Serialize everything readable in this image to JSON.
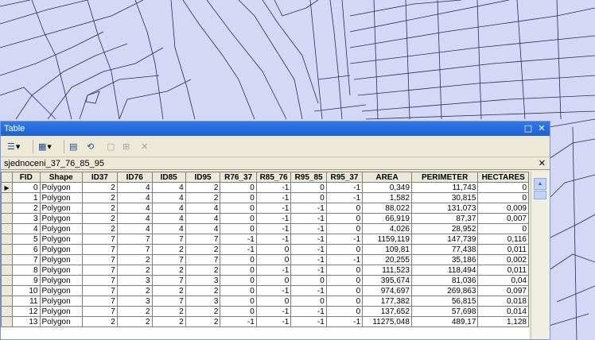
{
  "window": {
    "title": "Table",
    "maximize_glyph": "□",
    "close_glyph": "✕"
  },
  "toolbar": {
    "icons": [
      "table-options-icon",
      "related-tables-icon",
      "select-by-attributes-icon",
      "switch-selection-icon",
      "clear-selection-icon",
      "zoom-to-selected-icon",
      "delete-selected-icon"
    ]
  },
  "tab": {
    "label": "sjednoceni_37_76_85_95",
    "close_glyph": "✕"
  },
  "table": {
    "columns": [
      "FID",
      "Shape",
      "ID37",
      "ID76",
      "ID85",
      "ID95",
      "R76_37",
      "R85_76",
      "R95_85",
      "R95_37",
      "AREA",
      "PERIMETER",
      "HECTARES"
    ],
    "rows": [
      [
        "0",
        "Polygon",
        "2",
        "4",
        "4",
        "2",
        "0",
        "-1",
        "0",
        "-1",
        "0,349",
        "11,743",
        "0"
      ],
      [
        "1",
        "Polygon",
        "2",
        "4",
        "4",
        "2",
        "0",
        "-1",
        "0",
        "-1",
        "1,582",
        "30,815",
        "0"
      ],
      [
        "2",
        "Polygon",
        "2",
        "4",
        "4",
        "4",
        "0",
        "-1",
        "-1",
        "0",
        "88,022",
        "131,073",
        "0,009"
      ],
      [
        "3",
        "Polygon",
        "2",
        "4",
        "4",
        "4",
        "0",
        "-1",
        "-1",
        "0",
        "66,919",
        "87,37",
        "0,007"
      ],
      [
        "4",
        "Polygon",
        "2",
        "4",
        "4",
        "4",
        "0",
        "-1",
        "-1",
        "0",
        "4,026",
        "28,952",
        "0"
      ],
      [
        "5",
        "Polygon",
        "7",
        "7",
        "7",
        "7",
        "-1",
        "-1",
        "-1",
        "-1",
        "1159,119",
        "147,739",
        "0,116"
      ],
      [
        "6",
        "Polygon",
        "7",
        "7",
        "2",
        "2",
        "-1",
        "0",
        "-1",
        "0",
        "109,81",
        "77,438",
        "0,011"
      ],
      [
        "7",
        "Polygon",
        "7",
        "2",
        "7",
        "7",
        "0",
        "0",
        "-1",
        "-1",
        "20,255",
        "35,186",
        "0,002"
      ],
      [
        "8",
        "Polygon",
        "7",
        "2",
        "2",
        "2",
        "0",
        "-1",
        "-1",
        "0",
        "111,523",
        "118,494",
        "0,011"
      ],
      [
        "9",
        "Polygon",
        "7",
        "3",
        "7",
        "3",
        "0",
        "0",
        "0",
        "0",
        "395,674",
        "81,036",
        "0,04"
      ],
      [
        "10",
        "Polygon",
        "7",
        "2",
        "2",
        "2",
        "0",
        "-1",
        "-1",
        "0",
        "974,697",
        "269,863",
        "0,097"
      ],
      [
        "11",
        "Polygon",
        "7",
        "3",
        "7",
        "3",
        "0",
        "0",
        "0",
        "0",
        "177,382",
        "56,815",
        "0,018"
      ],
      [
        "12",
        "Polygon",
        "7",
        "2",
        "2",
        "2",
        "0",
        "-1",
        "-1",
        "0",
        "137,652",
        "57,698",
        "0,014"
      ],
      [
        "13",
        "Polygon",
        "2",
        "2",
        "2",
        "2",
        "-1",
        "-1",
        "-1",
        "-1",
        "11275,048",
        "489,17",
        "1,128"
      ]
    ],
    "current_row_marker": "▶",
    "colors": {
      "header": "#ece9d8",
      "grid_line": "#808080",
      "map_fill": "#d4d8f4",
      "title_bar": "#2163d6"
    }
  }
}
